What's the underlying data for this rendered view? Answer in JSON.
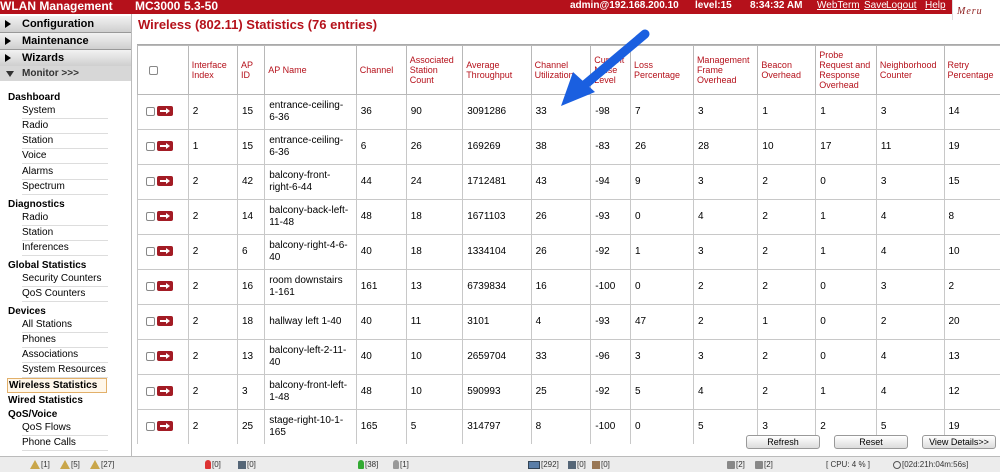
{
  "topbar": {
    "app_title": "WLAN Management",
    "controller": "MC3000",
    "version": "5.3-50",
    "user": "admin@192.168.200.10",
    "level": "level:15",
    "time": "8:34:32 AM",
    "links": {
      "webterm": "WebTerm",
      "save": "Save",
      "logout": "Logout",
      "help": "Help"
    },
    "logo_text": "Meru"
  },
  "sidebar": {
    "top_menus": [
      "Configuration",
      "Maintenance",
      "Wizards"
    ],
    "monitor_label": "Monitor >>>",
    "sections": [
      {
        "title": "Dashboard",
        "items": [
          "System",
          "Radio",
          "Station",
          "Voice",
          "Alarms",
          "Spectrum"
        ]
      },
      {
        "title": "Diagnostics",
        "items": [
          "Radio",
          "Station",
          "Inferences"
        ]
      },
      {
        "title": "Global Statistics",
        "items": [
          "Security Counters",
          "QoS Counters"
        ]
      },
      {
        "title": "Devices",
        "items": [
          "All Stations",
          "Phones",
          "Associations",
          "System Resources"
        ]
      }
    ],
    "selected": "Wireless Statistics",
    "wired": "Wired Statistics",
    "qos_voice": {
      "title": "QoS/Voice",
      "items": [
        "QoS Flows",
        "Phone Calls"
      ]
    }
  },
  "main": {
    "title": "Wireless (802.11) Statistics (76 entries)",
    "columns": [
      "Interface Index",
      "AP ID",
      "AP Name",
      "Channel",
      "Associated Station Count",
      "Average Throughput",
      "Channel Utilization",
      "Current Noise Level",
      "Loss Percentage",
      "Management Frame Overhead",
      "Beacon Overhead",
      "Probe Request and Response Overhead",
      "Neighborhood Counter",
      "Retry Percentage"
    ],
    "rows": [
      [
        "2",
        "15",
        "entrance-ceiling-6-36",
        "36",
        "90",
        "3091286",
        "33",
        "-98",
        "7",
        "3",
        "1",
        "1",
        "3",
        "14"
      ],
      [
        "1",
        "15",
        "entrance-ceiling-6-36",
        "6",
        "26",
        "169269",
        "38",
        "-83",
        "26",
        "28",
        "10",
        "17",
        "11",
        "19"
      ],
      [
        "2",
        "42",
        "balcony-front-right-6-44",
        "44",
        "24",
        "1712481",
        "43",
        "-94",
        "9",
        "3",
        "2",
        "0",
        "3",
        "15"
      ],
      [
        "2",
        "14",
        "balcony-back-left-11-48",
        "48",
        "18",
        "1671103",
        "26",
        "-93",
        "0",
        "4",
        "2",
        "1",
        "4",
        "8"
      ],
      [
        "2",
        "6",
        "balcony-right-4-6-40",
        "40",
        "18",
        "1334104",
        "26",
        "-92",
        "1",
        "3",
        "2",
        "1",
        "4",
        "10"
      ],
      [
        "2",
        "16",
        "room downstairs 1-161",
        "161",
        "13",
        "6739834",
        "16",
        "-100",
        "0",
        "2",
        "2",
        "0",
        "3",
        "2"
      ],
      [
        "2",
        "18",
        "hallway left 1-40",
        "40",
        "11",
        "3101",
        "4",
        "-93",
        "47",
        "2",
        "1",
        "0",
        "2",
        "20"
      ],
      [
        "2",
        "13",
        "balcony-left-2-11-40",
        "40",
        "10",
        "2659704",
        "33",
        "-96",
        "3",
        "3",
        "2",
        "0",
        "4",
        "13"
      ],
      [
        "2",
        "3",
        "balcony-front-left-1-48",
        "48",
        "10",
        "590993",
        "25",
        "-92",
        "5",
        "4",
        "2",
        "1",
        "4",
        "12"
      ],
      [
        "2",
        "25",
        "stage-right-10-1-165",
        "165",
        "5",
        "314797",
        "8",
        "-100",
        "0",
        "5",
        "3",
        "2",
        "5",
        "19"
      ]
    ],
    "buttons": {
      "refresh": "Refresh",
      "reset": "Reset",
      "view_details": "View Details>>"
    }
  },
  "status": {
    "alarm_critical": "[1]",
    "alarm_major": "[5]",
    "alarm_minor": "[27]",
    "ap_down": "[0]",
    "ap_other": "[0]",
    "ap_up": "[38]",
    "ap_na": "[1]",
    "stations": "[292]",
    "phones": "[0]",
    "devices": "[0]",
    "lock_a": "[2]",
    "lock_b": "[2]",
    "cpu": "[ CPU: 4 % ]",
    "uptime": "[02d:21h:04m:56s]"
  }
}
